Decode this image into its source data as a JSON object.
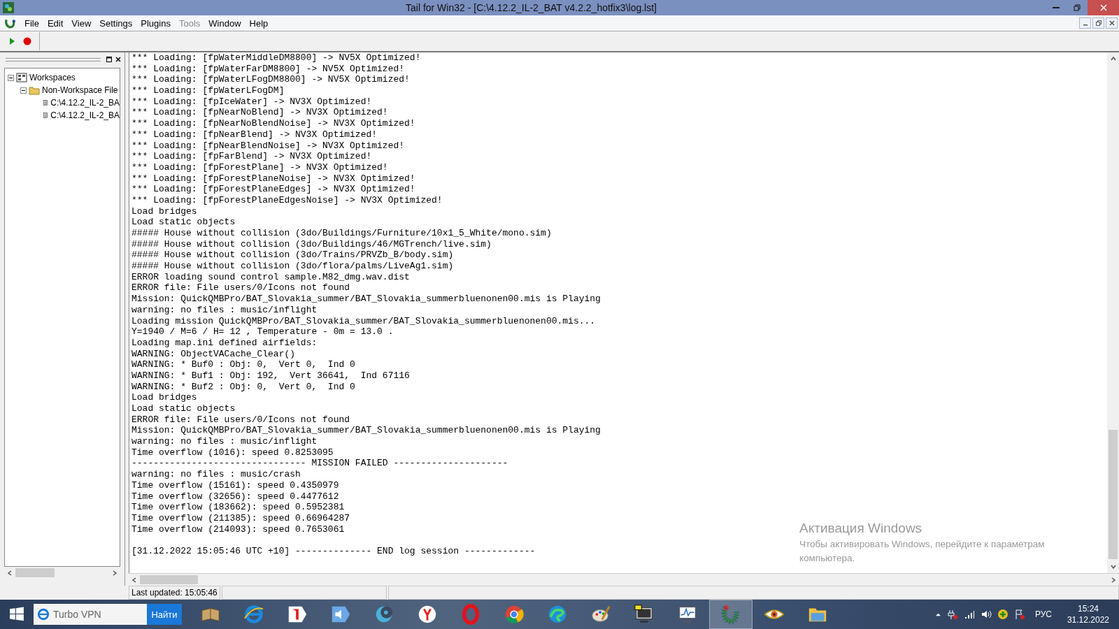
{
  "window": {
    "title": "Tail for Win32 - [C:\\4.12.2_IL-2_BAT v4.2.2_hotfix3\\log.lst]"
  },
  "menu": [
    {
      "label": "File",
      "disabled": false
    },
    {
      "label": "Edit",
      "disabled": false
    },
    {
      "label": "View",
      "disabled": false
    },
    {
      "label": "Settings",
      "disabled": false
    },
    {
      "label": "Plugins",
      "disabled": false
    },
    {
      "label": "Tools",
      "disabled": true
    },
    {
      "label": "Window",
      "disabled": false
    },
    {
      "label": "Help",
      "disabled": false
    }
  ],
  "toolbar": [
    {
      "kind": "play",
      "disabled": false
    },
    {
      "kind": "stop",
      "disabled": false
    }
  ],
  "tree": [
    {
      "label": "Workspaces",
      "expanded": true,
      "children": [
        {
          "label": "Non-Workspace File",
          "expanded": true,
          "children": [
            {
              "label": "C:\\4.12.2_IL-2_BA"
            },
            {
              "label": "C:\\4.12.2_IL-2_BA"
            }
          ]
        }
      ]
    }
  ],
  "log": [
    "*** Loading: [fpWaterMiddleDM8800] -> NV5X Optimized!",
    "*** Loading: [fpWaterFarDM8800] -> NV5X Optimized!",
    "*** Loading: [fpWaterLFogDM8800] -> NV5X Optimized!",
    "*** Loading: [fpWaterLFogDM]",
    "*** Loading: [fpIceWater] -> NV3X Optimized!",
    "*** Loading: [fpNearNoBlend] -> NV3X Optimized!",
    "*** Loading: [fpNearNoBlendNoise] -> NV3X Optimized!",
    "*** Loading: [fpNearBlend] -> NV3X Optimized!",
    "*** Loading: [fpNearBlendNoise] -> NV3X Optimized!",
    "*** Loading: [fpFarBlend] -> NV3X Optimized!",
    "*** Loading: [fpForestPlane] -> NV3X Optimized!",
    "*** Loading: [fpForestPlaneNoise] -> NV3X Optimized!",
    "*** Loading: [fpForestPlaneEdges] -> NV3X Optimized!",
    "*** Loading: [fpForestPlaneEdgesNoise] -> NV3X Optimized!",
    "Load bridges",
    "Load static objects",
    "##### House without collision (3do/Buildings/Furniture/10x1_5_White/mono.sim)",
    "##### House without collision (3do/Buildings/46/MGTrench/live.sim)",
    "##### House without collision (3do/Trains/PRVZb_B/body.sim)",
    "##### House without collision (3do/flora/palms/LiveAg1.sim)",
    "ERROR loading sound control sample.M82_dmg.wav.dist",
    "ERROR file: File users/0/Icons not found",
    "Mission: QuickQMBPro/BAT_Slovakia_summer/BAT_Slovakia_summerbluenonen00.mis is Playing",
    "warning: no files : music/inflight",
    "Loading mission QuickQMBPro/BAT_Slovakia_summer/BAT_Slovakia_summerbluenonen00.mis...",
    "Y=1940 / M=6 / H= 12 , Temperature - 0m = 13.0 .",
    "Loading map.ini defined airfields:",
    "WARNING: ObjectVACache_Clear()",
    "WARNING: * Buf0 : Obj: 0,  Vert 0,  Ind 0",
    "WARNING: * Buf1 : Obj: 192,  Vert 36641,  Ind 67116",
    "WARNING: * Buf2 : Obj: 0,  Vert 0,  Ind 0",
    "Load bridges",
    "Load static objects",
    "ERROR file: File users/0/Icons not found",
    "Mission: QuickQMBPro/BAT_Slovakia_summer/BAT_Slovakia_summerbluenonen00.mis is Playing",
    "warning: no files : music/inflight",
    "Time overflow (1016): speed 0.8253095",
    "-------------------------------- MISSION FAILED ---------------------",
    "warning: no files : music/crash",
    "Time overflow (15161): speed 0.4350979",
    "Time overflow (32656): speed 0.4477612",
    "Time overflow (183662): speed 0.5952381",
    "Time overflow (211385): speed 0.66964287",
    "Time overflow (214093): speed 0.7653061"
  ],
  "log_end": "[31.12.2022 15:05:46 UTC +10] -------------- END log session -------------",
  "activation_notice": {
    "title": "Активация Windows",
    "text": "Чтобы активировать Windows, перейдите к параметрам компьютера."
  },
  "status_bar": {
    "last_updated": "Last updated: 15:05:46"
  },
  "taskbar": {
    "search": {
      "placeholder": "Turbo VPN",
      "button": "Найти"
    },
    "apps": [
      {
        "kind": "book",
        "selected": false
      },
      {
        "kind": "ie",
        "selected": false
      },
      {
        "kind": "tag",
        "selected": false
      },
      {
        "kind": "speaker",
        "selected": false
      },
      {
        "kind": "crescent",
        "selected": false
      },
      {
        "kind": "ycircle",
        "selected": false
      },
      {
        "kind": "ring",
        "selected": false
      },
      {
        "kind": "wheel",
        "selected": false
      },
      {
        "kind": "swirl",
        "selected": false
      },
      {
        "kind": "palette",
        "selected": false
      },
      {
        "kind": "monitor",
        "selected": false
      },
      {
        "kind": "chartmon",
        "selected": false
      },
      {
        "kind": "caterpillar",
        "selected": true
      },
      {
        "kind": "eye",
        "selected": false
      },
      {
        "kind": "folder",
        "selected": false
      }
    ],
    "language": "РУС",
    "time": "15:24",
    "date": "31.12.2022"
  }
}
